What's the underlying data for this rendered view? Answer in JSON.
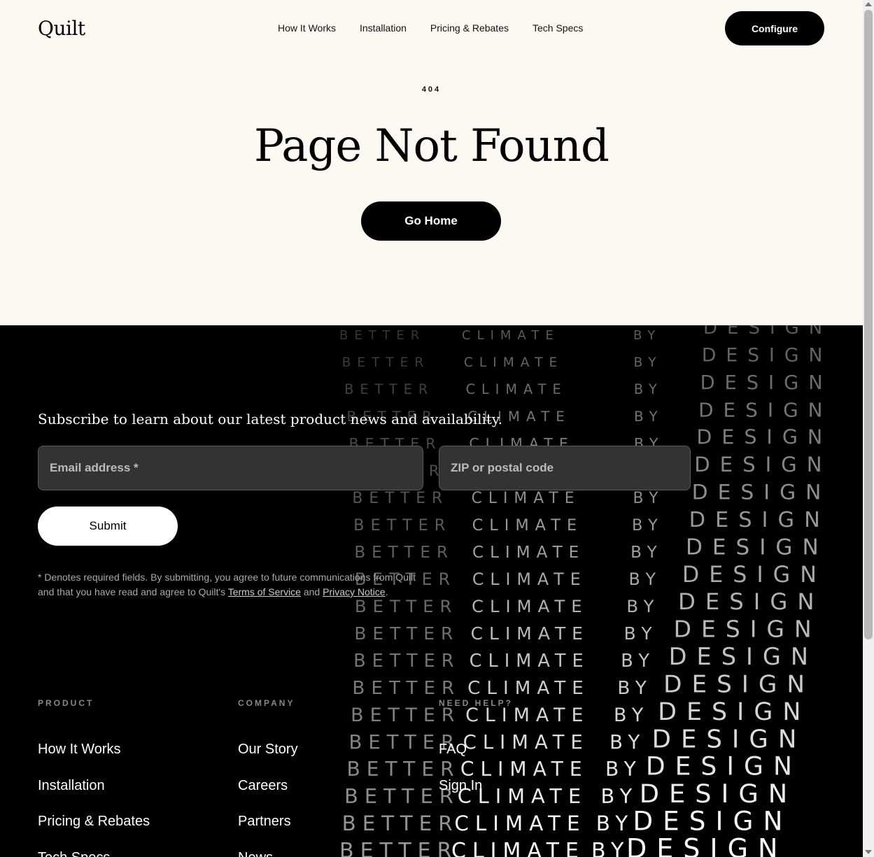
{
  "header": {
    "logo": "Quilt",
    "nav": [
      "How It Works",
      "Installation",
      "Pricing & Rebates",
      "Tech Specs"
    ],
    "configure_label": "Configure"
  },
  "error": {
    "code": "404",
    "title": "Page Not Found",
    "go_home_label": "Go Home"
  },
  "art": {
    "words": [
      "BETTER",
      "CLIMATE",
      "BY",
      "DESIGN"
    ]
  },
  "newsletter": {
    "heading": "Subscribe to learn about our latest product news and availability.",
    "email_placeholder": "Email address *",
    "zip_placeholder": "ZIP or postal code",
    "submit_label": "Submit",
    "legal_prefix": "* Denotes required fields. By submitting, you agree to future communications from Quilt and that you have read and agree to Quilt's ",
    "terms_label": "Terms of Service",
    "legal_and": " and ",
    "privacy_label": "Privacy Notice",
    "legal_suffix": "."
  },
  "footer_columns": [
    {
      "heading": "PRODUCT",
      "links": [
        "How It Works",
        "Installation",
        "Pricing & Rebates",
        "Tech Specs"
      ]
    },
    {
      "heading": "COMPANY",
      "links": [
        "Our Story",
        "Careers",
        "Partners",
        "News"
      ]
    },
    {
      "heading": "NEED HELP?",
      "links": [
        "FAQ",
        "Sign In"
      ]
    }
  ],
  "colors": {
    "background_light": "#fcf9f3",
    "background_dark": "#000000",
    "accent": "#000000"
  }
}
